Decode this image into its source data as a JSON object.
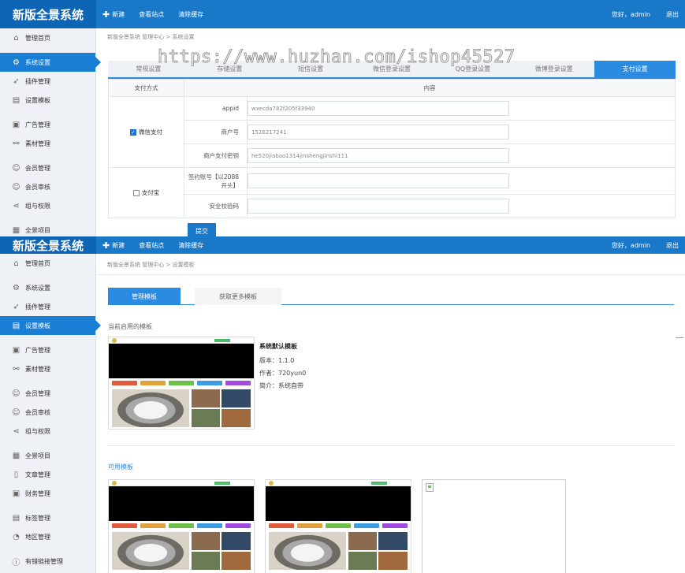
{
  "app": {
    "logo": "新版全景系统"
  },
  "topnav": {
    "new_label": "新建",
    "view_site_label": "查看站点",
    "clear_cache_label": "清除缓存",
    "greeting": "您好，admin",
    "logout_label": "退出"
  },
  "watermark": "https://www.huzhan.com/ishop45527",
  "panel1": {
    "sidebar": [
      {
        "label": "管理首页",
        "icon": "home-icon"
      },
      {
        "label": "系统设置",
        "icon": "gear-icon"
      },
      {
        "label": "插件管理",
        "icon": "send-icon"
      },
      {
        "label": "设置模板",
        "icon": "template-icon"
      },
      {
        "label": "广告管理",
        "icon": "ad-icon"
      },
      {
        "label": "素材管理",
        "icon": "link-icon"
      },
      {
        "label": "会员管理",
        "icon": "users-icon"
      },
      {
        "label": "会员审核",
        "icon": "users-icon"
      },
      {
        "label": "组与权限",
        "icon": "share-icon"
      },
      {
        "label": "全景项目",
        "icon": "grid-icon"
      }
    ],
    "breadcrumb": "新版全景系统 管理中心  >  系统设置",
    "tabs": [
      "常规设置",
      "存储设置",
      "短信设置",
      "微信登录设置",
      "QQ登录设置",
      "微博登录设置",
      "支付设置"
    ],
    "table": {
      "col_method": "支付方式",
      "col_content": "内容",
      "wechat": {
        "label": "微信支付",
        "checked": true,
        "fields": [
          {
            "label": "appid",
            "value": "wxecda782f205f33940"
          },
          {
            "label": "商户号",
            "value": "1526217241"
          },
          {
            "label": "商户支付密钥",
            "value": "he520jiabao1314jinshengjinshi111"
          }
        ]
      },
      "alipay": {
        "label": "支付宝",
        "checked": false,
        "fields": [
          {
            "label": "签约账号【以2088开头】",
            "value": ""
          },
          {
            "label": "安全校验码",
            "value": ""
          }
        ]
      }
    },
    "submit_label": "提交"
  },
  "panel2": {
    "sidebar": [
      {
        "label": "管理首页",
        "icon": "home-icon"
      },
      {
        "label": "系统设置",
        "icon": "gear-icon"
      },
      {
        "label": "插件管理",
        "icon": "send-icon"
      },
      {
        "label": "设置模板",
        "icon": "template-icon"
      },
      {
        "label": "广告管理",
        "icon": "ad-icon"
      },
      {
        "label": "素材管理",
        "icon": "link-icon"
      },
      {
        "label": "会员管理",
        "icon": "users-icon"
      },
      {
        "label": "会员审核",
        "icon": "users-icon"
      },
      {
        "label": "组与权限",
        "icon": "share-icon"
      },
      {
        "label": "全景项目",
        "icon": "grid-icon"
      },
      {
        "label": "文章管理",
        "icon": "document-icon"
      },
      {
        "label": "财务管理",
        "icon": "finance-icon"
      },
      {
        "label": "标签管理",
        "icon": "tag-icon"
      },
      {
        "label": "地区管理",
        "icon": "region-icon"
      },
      {
        "label": "有错链接管理",
        "icon": "warning-icon"
      }
    ],
    "breadcrumb": "新版全景系统 管理中心  >  设置模板",
    "tabs": [
      "管理模板",
      "获取更多模板"
    ],
    "current_title": "当前启用的模板",
    "template": {
      "name": "系统默认模板",
      "version": "版本：1.1.0",
      "author": "作者：720yun0",
      "desc": "简介：系统自带"
    },
    "available_title": "可用模板"
  }
}
